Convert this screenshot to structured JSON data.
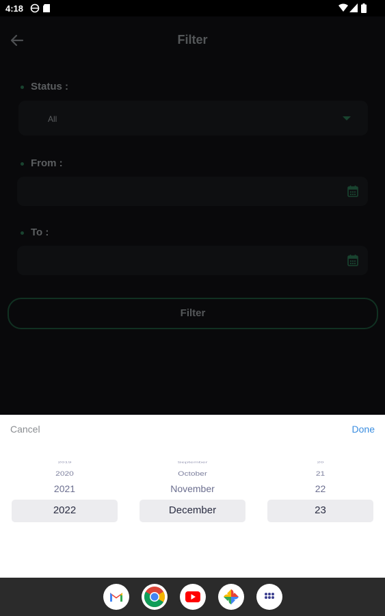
{
  "status_bar": {
    "time": "4:18"
  },
  "header": {
    "title": "Filter"
  },
  "form": {
    "status": {
      "label": "Status :",
      "value": "All"
    },
    "from": {
      "label": "From :",
      "value": ""
    },
    "to": {
      "label": "To :",
      "value": ""
    },
    "filter_button_label": "Filter"
  },
  "date_picker": {
    "cancel_label": "Cancel",
    "done_label": "Done",
    "years": [
      "2019",
      "2020",
      "2021",
      "2022"
    ],
    "months": [
      "September",
      "October",
      "November",
      "December"
    ],
    "days": [
      "20",
      "21",
      "22",
      "23"
    ],
    "selected": {
      "year": "2022",
      "month": "December",
      "day": "23"
    }
  },
  "dock": {
    "apps": [
      "gmail-icon",
      "chrome-icon",
      "youtube-icon",
      "photos-icon",
      "app-drawer-icon"
    ]
  },
  "colors": {
    "accent_green": "#2e7a57",
    "done_blue": "#3a8de0"
  }
}
